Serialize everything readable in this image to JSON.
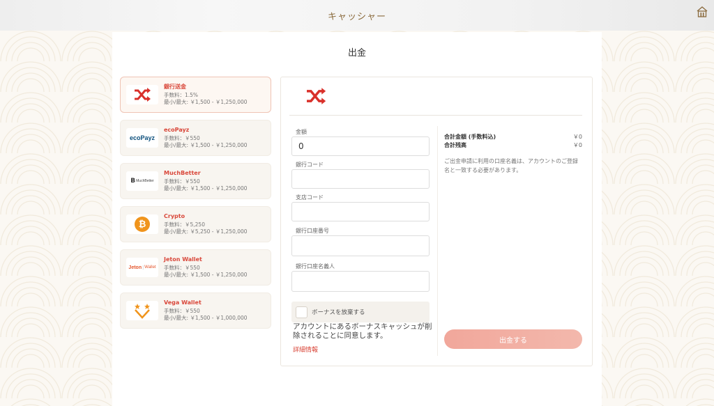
{
  "header": {
    "title": "キャッシャー"
  },
  "page": {
    "title": "出金"
  },
  "methods": [
    {
      "name": "銀行送金",
      "fee": "手数料：1.5%",
      "range": "最小/最大: ￥1,500 - ￥1,250,000",
      "icon": "shuffle-icon"
    },
    {
      "name": "ecoPayz",
      "fee": "手数料：￥550",
      "range": "最小/最大: ￥1,500 - ￥1,250,000",
      "icon": "ecopayz-logo",
      "logo_text": "ecoPayz"
    },
    {
      "name": "MuchBetter",
      "fee": "手数料：￥550",
      "range": "最小/最大: ￥1,500 - ￥1,250,000",
      "icon": "muchbetter-logo",
      "logo_text": "MuchBetter"
    },
    {
      "name": "Crypto",
      "fee": "手数料：￥5,250",
      "range": "最小/最大: ￥5,250 - ￥1,250,000",
      "icon": "bitcoin-icon",
      "logo_text": "₿"
    },
    {
      "name": "Jeton Wallet",
      "fee": "手数料：￥550",
      "range": "最小/最大: ￥1,500 - ￥1,250,000",
      "icon": "jeton-logo",
      "logo_text": "Jeton",
      "logo_text_2": "Wallet"
    },
    {
      "name": "Vega Wallet",
      "fee": "手数料：￥550",
      "range": "最小/最大: ￥1,500 - ￥1,000,000",
      "icon": "vega-logo"
    }
  ],
  "form": {
    "amount_label": "金額",
    "amount_value": "0",
    "bank_code_label": "銀行コード",
    "branch_code_label": "支店コード",
    "account_number_label": "銀行口座番号",
    "account_name_label": "銀行口座名義人",
    "bonus_label": "ボーナスを放棄する",
    "bonus_note": "アカウントにあるボーナスキャッシュが削除されることに同意します。",
    "details_link": "詳細情報"
  },
  "summary": {
    "total_label": "合計金額 (手数料込)",
    "total_value": "￥0",
    "balance_label": "合計残高",
    "balance_value": "￥0",
    "notice": "ご出金申請に利用の口座名義は、アカウントのご登録名と一致する必要があります。",
    "submit_label": "出金する"
  },
  "colors": {
    "accent": "#d9473a",
    "brand_gold": "#8a6a3c",
    "button": "#f1a79b"
  }
}
